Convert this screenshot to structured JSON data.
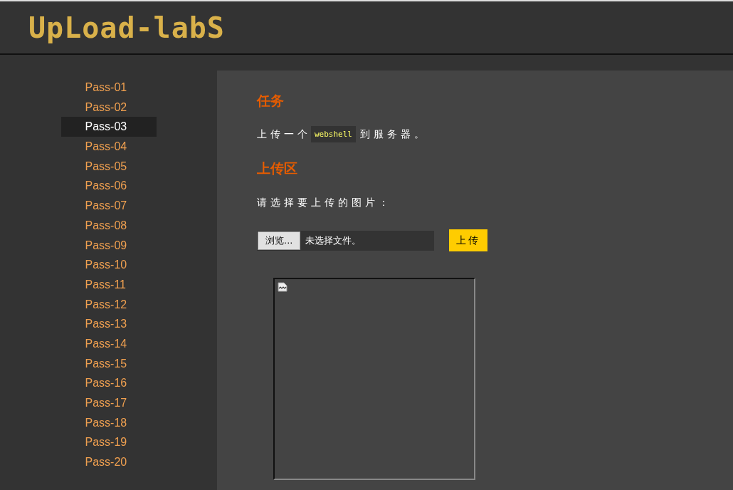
{
  "header": {
    "logo": "UpLoad-labS"
  },
  "sidebar": {
    "items": [
      {
        "label": "Pass-01",
        "selected": false
      },
      {
        "label": "Pass-02",
        "selected": false
      },
      {
        "label": "Pass-03",
        "selected": true
      },
      {
        "label": "Pass-04",
        "selected": false
      },
      {
        "label": "Pass-05",
        "selected": false
      },
      {
        "label": "Pass-06",
        "selected": false
      },
      {
        "label": "Pass-07",
        "selected": false
      },
      {
        "label": "Pass-08",
        "selected": false
      },
      {
        "label": "Pass-09",
        "selected": false
      },
      {
        "label": "Pass-10",
        "selected": false
      },
      {
        "label": "Pass-11",
        "selected": false
      },
      {
        "label": "Pass-12",
        "selected": false
      },
      {
        "label": "Pass-13",
        "selected": false
      },
      {
        "label": "Pass-14",
        "selected": false
      },
      {
        "label": "Pass-15",
        "selected": false
      },
      {
        "label": "Pass-16",
        "selected": false
      },
      {
        "label": "Pass-17",
        "selected": false
      },
      {
        "label": "Pass-18",
        "selected": false
      },
      {
        "label": "Pass-19",
        "selected": false
      },
      {
        "label": "Pass-20",
        "selected": false
      }
    ]
  },
  "task": {
    "heading": "任务",
    "text_before": "上传一个",
    "code": "webshell",
    "text_after": "到服务器。"
  },
  "upload": {
    "heading": "上传区",
    "prompt": "请选择要上传的图片：",
    "browse_button": "浏览...",
    "file_status": "未选择文件。",
    "submit_button": "上传"
  }
}
